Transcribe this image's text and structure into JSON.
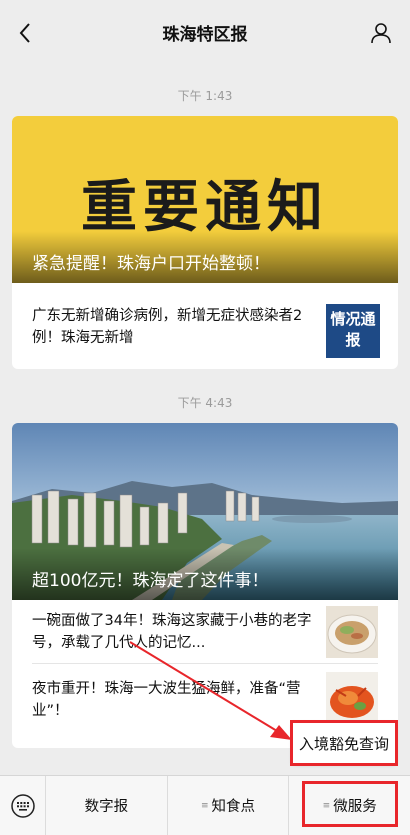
{
  "header": {
    "title": "珠海特区报"
  },
  "messages": [
    {
      "time": "下午 1:43",
      "hero_big_text": "重要通知",
      "hero_caption": "紧急提醒！珠海户口开始整顿！",
      "sub_news": "广东无新增确诊病例，新增无症状感染者2例！珠海无新增",
      "thumb_text": "情况通报"
    },
    {
      "time": "下午 4:43",
      "hero_caption": "超100亿元！珠海定了这件事！",
      "items": [
        {
          "text": "一碗面做了34年！珠海这家藏于小巷的老字号，承载了几代人的记忆..."
        },
        {
          "text": "夜市重开！珠海一大波生猛海鲜，准备“营业”！"
        }
      ]
    }
  ],
  "popup": {
    "label": "入境豁免查询"
  },
  "bottom_menu": {
    "items": [
      {
        "label": "数字报",
        "has_submenu": false
      },
      {
        "label": "知食点",
        "has_submenu": true
      },
      {
        "label": "微服务",
        "has_submenu": true
      }
    ]
  },
  "colors": {
    "notice_yellow": "#f3cd3c",
    "annotation_red": "#e8262b",
    "thumb_blue": "#1e4a86"
  },
  "icons": {
    "back": "chevron-left-icon",
    "profile": "person-icon",
    "keyboard": "keyboard-icon",
    "submenu": "menu-lines-icon"
  }
}
